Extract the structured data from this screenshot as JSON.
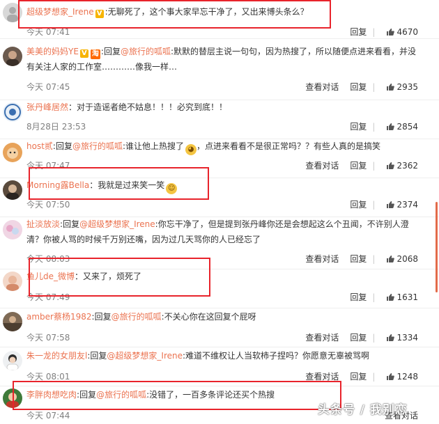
{
  "labels": {
    "view_thread": "查看对话",
    "reply": "回复",
    "reply_prefix": "回复"
  },
  "colors": {
    "accent": "#eb7350",
    "highlight_box": "#e8232b"
  },
  "comments": [
    {
      "user": "超级梦想家_Irene",
      "badge": "V",
      "text": ":无聊死了，这个事大家早忘干净了，又出来博头条么？",
      "time": "今天 07:41",
      "likes": "4670",
      "has_thread": false
    },
    {
      "user": "美美的妈妈YE",
      "badge": "V",
      "badge2": "淘",
      "reply_to": "@旅行的呱呱",
      "text": ":默默的替层主说一句句，因为热搜了，所以随便点进来看看，并没有关注人家的工作室…………像我一样…",
      "time": "今天 07:45",
      "likes": "2935",
      "has_thread": true
    },
    {
      "user": "张丹峰居然",
      "text": "：对于造谣者绝不姑息！！！必究到底！！",
      "time": "8月28日 23:53",
      "likes": "2854",
      "has_thread": false
    },
    {
      "user": "host贰",
      "reply_to": "@旅行的呱呱",
      "text": ":谁让他上热搜了",
      "text2": "，点进来看看不是很正常吗？？有些人真的是搞笑",
      "time": "今天 07:47",
      "likes": "2362",
      "has_thread": true
    },
    {
      "user": "Morning露Bella",
      "text": "：我就是过来笑一笑",
      "time": "今天 07:50",
      "likes": "2374",
      "has_thread": false
    },
    {
      "user": "扯淡放淡",
      "reply_to": "@超级梦想家_Irene",
      "text": ":你忘干净了，但是提到张丹峰你还是会想起这么个丑闻，不许别人澄清？你被人骂的时候千万别还嘴，因为过几天骂你的人已经忘了",
      "time": "今天 08:03",
      "likes": "2068",
      "has_thread": true
    },
    {
      "user": "鱼儿de_微博",
      "text": "：又来了，烦死了",
      "time": "今天 07:49",
      "likes": "1631",
      "has_thread": false
    },
    {
      "user": "amber蔡杨1982",
      "reply_to": "@旅行的呱呱",
      "text": ":不关心你在这回复个屁呀",
      "time": "今天 07:58",
      "likes": "1334",
      "has_thread": true
    },
    {
      "user": "朱一龙的女朋友l",
      "reply_to": "@超级梦想家_Irene",
      "text": ":难道不维权让人当软柿子捏吗？你愿意无辜被骂啊",
      "time": "今天 08:01",
      "likes": "1248",
      "has_thread": true
    },
    {
      "user": "李胖肉想吃肉",
      "reply_to": "@旅行的呱呱",
      "text": ":没错了，一百多条评论还买个热搜",
      "time": "今天 07:44",
      "likes": "",
      "has_thread": true
    }
  ],
  "watermark": "头条号 / 我别恋"
}
